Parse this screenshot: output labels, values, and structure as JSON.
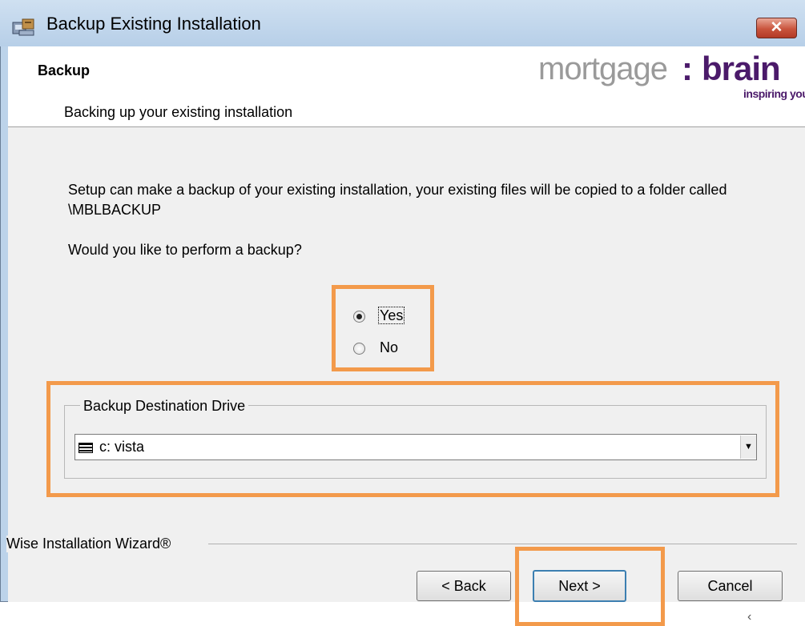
{
  "window": {
    "title": "Backup Existing Installation",
    "close_label": "✕"
  },
  "header": {
    "title": "Backup",
    "subtitle": "Backing up your existing installation",
    "logo": {
      "word1": "mortgage",
      "colon": ":",
      "word2": "brain",
      "tagline": "inspiring you"
    }
  },
  "body": {
    "description": "Setup can make a backup of your existing installation, your existing files will be copied to a folder called \\MBLBACKUP",
    "question": "Would you like to perform a backup?",
    "options": [
      {
        "label": "Yes",
        "selected": true
      },
      {
        "label": "No",
        "selected": false
      }
    ],
    "destination": {
      "group_label": "Backup Destination Drive",
      "selected_value": "c:  vista",
      "dropdown_arrow": "▼"
    }
  },
  "footer": {
    "wizard_label": "Wise Installation Wizard®",
    "buttons": {
      "back": "< Back",
      "next": "Next >",
      "cancel": "Cancel"
    }
  },
  "annotations": {
    "highlight_color": "#f39a4b"
  },
  "stray_mark": "‹"
}
